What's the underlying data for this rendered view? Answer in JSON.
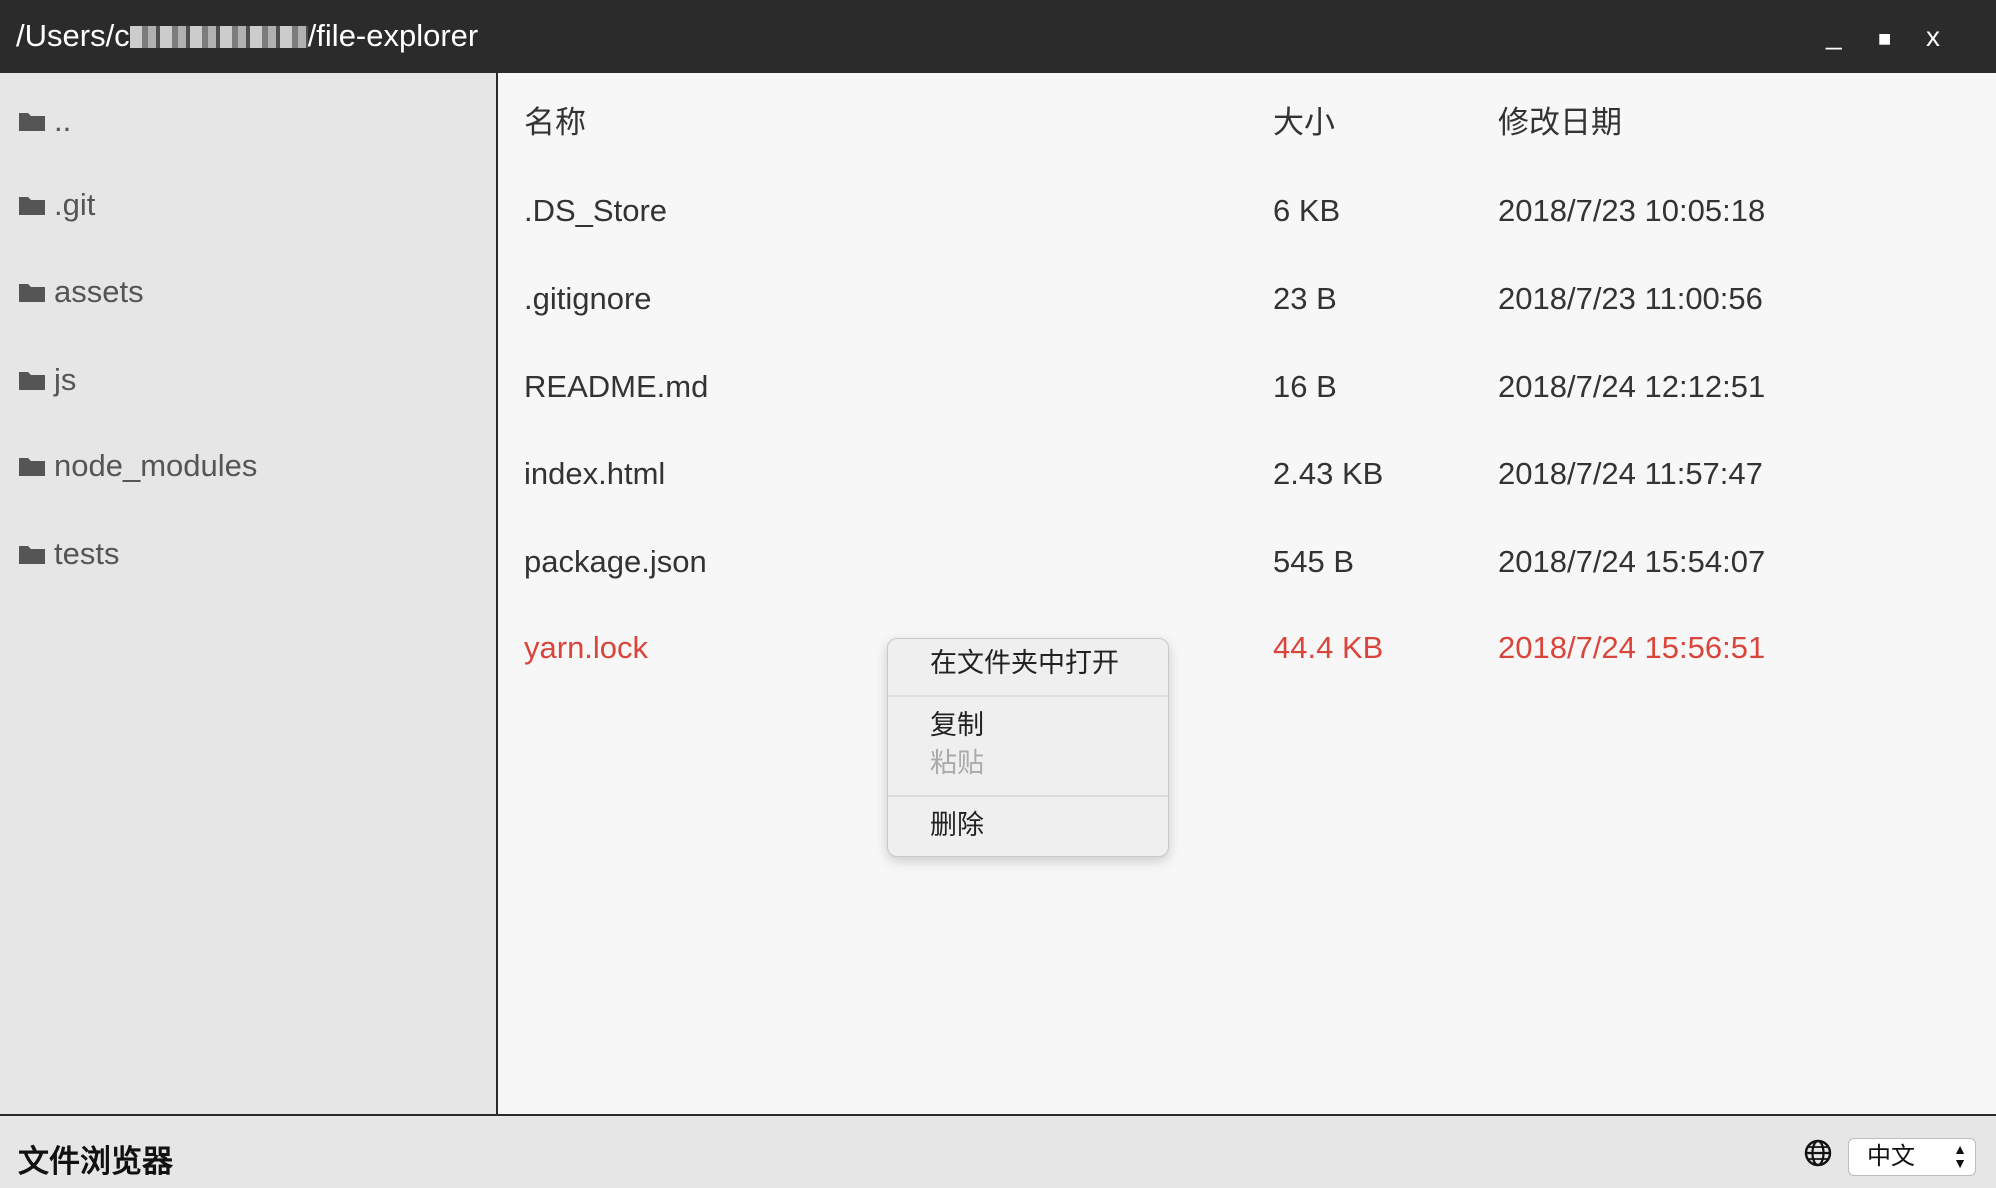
{
  "window": {
    "title_prefix": "/Users/c",
    "title_suffix": "/file-explorer",
    "minimize": "_",
    "maximize": "■",
    "close": "x"
  },
  "sidebar": {
    "items": [
      {
        "label": ".."
      },
      {
        "label": ".git"
      },
      {
        "label": "assets"
      },
      {
        "label": "js"
      },
      {
        "label": "node_modules"
      },
      {
        "label": "tests"
      }
    ]
  },
  "table": {
    "headers": {
      "name": "名称",
      "size": "大小",
      "modified": "修改日期"
    },
    "rows": [
      {
        "name": ".DS_Store",
        "size": "6 KB",
        "modified": "2018/7/23 10:05:18"
      },
      {
        "name": ".gitignore",
        "size": "23 B",
        "modified": "2018/7/23 11:00:56"
      },
      {
        "name": "README.md",
        "size": "16 B",
        "modified": "2018/7/24 12:12:51"
      },
      {
        "name": "index.html",
        "size": "2.43 KB",
        "modified": "2018/7/24 11:57:47"
      },
      {
        "name": "package.json",
        "size": "545 B",
        "modified": "2018/7/24 15:54:07"
      },
      {
        "name": "yarn.lock",
        "size": "44.4 KB",
        "modified": "2018/7/24 15:56:51"
      }
    ]
  },
  "context_menu": {
    "open_in_folder": "在文件夹中打开",
    "copy": "复制",
    "paste": "粘贴",
    "delete": "删除"
  },
  "footer": {
    "app_title": "文件浏览器",
    "language": "中文"
  },
  "colors": {
    "titlebar": "#2b2b2b",
    "selected_text": "#d9453a",
    "sidebar_bg": "#e6e6e6",
    "main_bg": "#f7f7f7"
  }
}
